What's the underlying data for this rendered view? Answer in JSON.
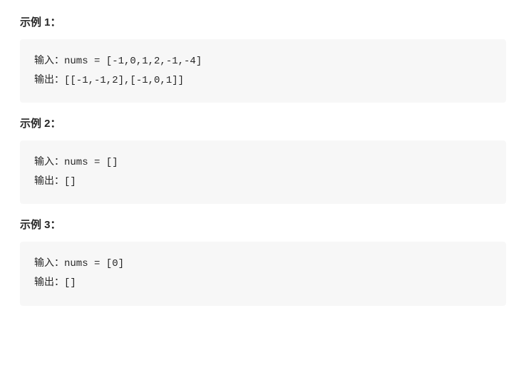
{
  "examples": [
    {
      "title": "示例 1：",
      "input_label": "输入：",
      "input_code": "nums = [-1,0,1,2,-1,-4]",
      "output_label": "输出：",
      "output_code": "[[-1,-1,2],[-1,0,1]]"
    },
    {
      "title": "示例 2：",
      "input_label": "输入：",
      "input_code": "nums = []",
      "output_label": "输出：",
      "output_code": "[]"
    },
    {
      "title": "示例 3：",
      "input_label": "输入：",
      "input_code": "nums = [0]",
      "output_label": "输出：",
      "output_code": "[]"
    }
  ]
}
